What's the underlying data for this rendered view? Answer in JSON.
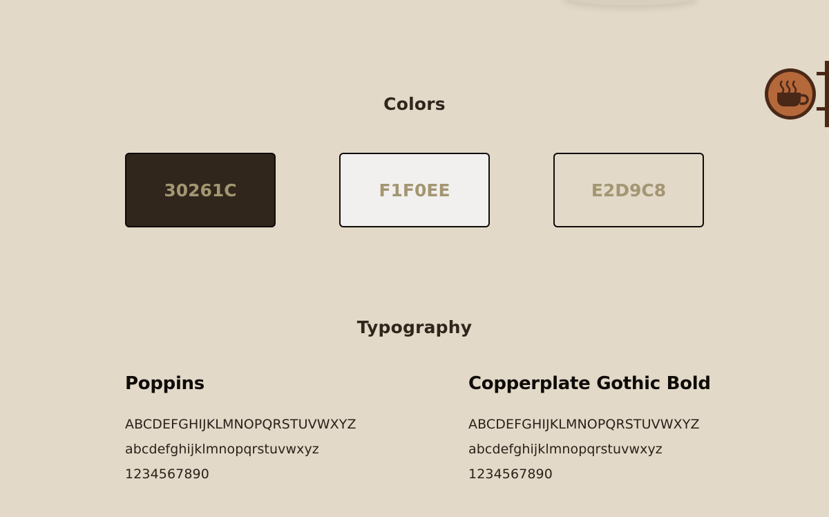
{
  "colors": {
    "title": "Colors",
    "swatches": [
      {
        "label": "30261C",
        "fill": "#30261c"
      },
      {
        "label": "F1F0EE",
        "fill": "#f1f0ee"
      },
      {
        "label": "E2D9C8",
        "fill": "#e2d9c8"
      }
    ],
    "label_color": "#a39672",
    "border_color": "#0e0b08"
  },
  "typography": {
    "title": "Typography",
    "fonts": [
      {
        "name": "Poppins",
        "uppercase": "ABCDEFGHIJKLMNOPQRSTUVWXYZ",
        "lowercase": "abcdefghijklmnopqrstuvwxyz",
        "digits": "1234567890"
      },
      {
        "name": "Copperplate Gothic Bold",
        "uppercase": "ABCDEFGHIJKLMNOPQRSTUVWXYZ",
        "lowercase": "abcdefghijklmnopqrstuvwxyz",
        "digits": "1234567890"
      }
    ]
  },
  "decor": {
    "sign_icon": "coffee-cup-icon",
    "sign_color": "#b5683a",
    "sign_border_color": "#4a2818",
    "background": "#e2d9c8"
  }
}
